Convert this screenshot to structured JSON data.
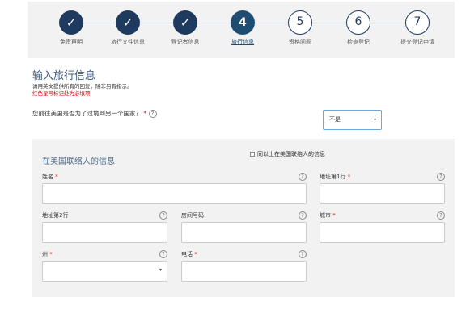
{
  "stepper": {
    "steps": [
      {
        "symbol": "✓",
        "label": "免责声明"
      },
      {
        "symbol": "✓",
        "label": "旅行文件信息"
      },
      {
        "symbol": "✓",
        "label": "登记者信息"
      },
      {
        "symbol": "4",
        "label": "旅行信息"
      },
      {
        "symbol": "5",
        "label": "资格问题"
      },
      {
        "symbol": "6",
        "label": "检查登记"
      },
      {
        "symbol": "7",
        "label": "提交登记申请"
      }
    ]
  },
  "page": {
    "title": "输入旅行信息",
    "instruction": "请用英文提供所有的回复，除非另有指示。",
    "required_note": "红色星号标记处为必填项"
  },
  "transit_question": {
    "text": "您前往美国是否为了过境到另一个国家？",
    "star": "*",
    "help": "?",
    "selected": "不是",
    "caret": "▾"
  },
  "contact": {
    "title": "在美国联络人的信息",
    "star": "*",
    "help": "?",
    "caret": "▾",
    "name_label": "姓名",
    "address1_label": "地址第1行",
    "address2_label": "地址第2行",
    "apartment_label": "房间号码",
    "city_label": "城市",
    "state_label": "州",
    "phone_label": "电话",
    "same_as_label": "同以上在美国联络人的信息"
  }
}
